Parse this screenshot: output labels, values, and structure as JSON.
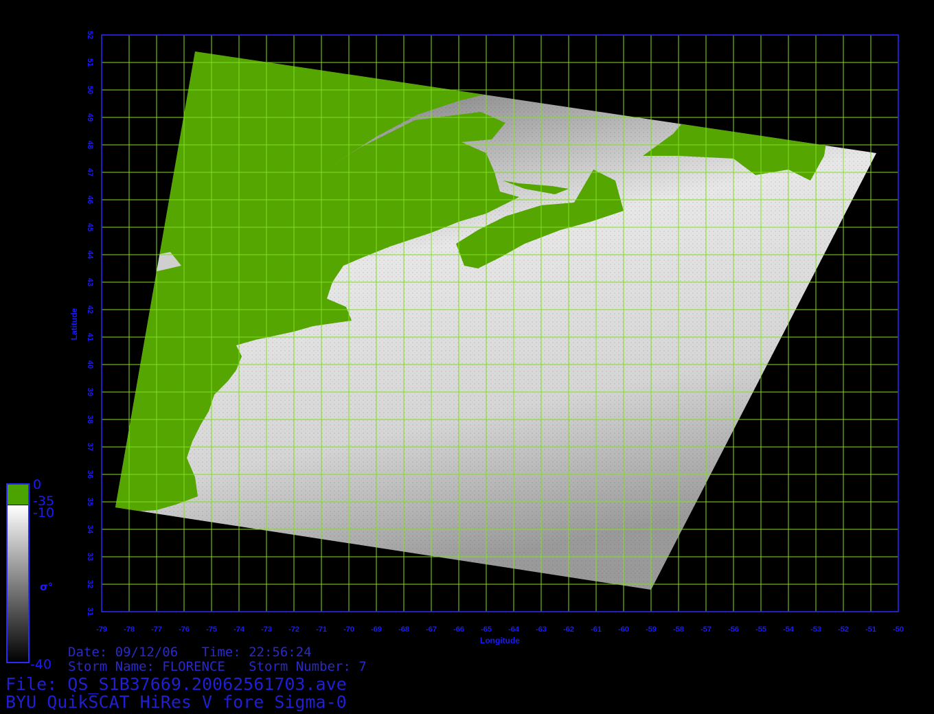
{
  "map": {
    "x_axis_label": "Longitude",
    "y_axis_label": "Latitude",
    "lon_range": [
      -79,
      -50
    ],
    "lat_range": [
      31,
      52
    ],
    "lon_ticks": [
      -79,
      -78,
      -77,
      -76,
      -75,
      -74,
      -73,
      -72,
      -71,
      -70,
      -69,
      -68,
      -67,
      -66,
      -65,
      -64,
      -63,
      -62,
      -61,
      -60,
      -59,
      -58,
      -57,
      -56,
      -55,
      -54,
      -53,
      -52,
      -51,
      -50
    ],
    "lat_ticks": [
      31,
      32,
      33,
      34,
      35,
      36,
      37,
      38,
      39,
      40,
      41,
      42,
      43,
      44,
      45,
      46,
      47,
      48,
      49,
      50,
      51,
      52
    ],
    "grid_color": "#7fe020",
    "frame_color": "#2a2aff",
    "land_color": "#55a600",
    "swath_corners": [
      [
        -75.6,
        51.4
      ],
      [
        -50.8,
        47.7
      ],
      [
        -59.0,
        31.8
      ],
      [
        -78.5,
        34.8
      ]
    ]
  },
  "colorbar": {
    "land_segment": {
      "top": "0",
      "bottom": "-35",
      "color": "#4aa300"
    },
    "sigma0_segment": {
      "top": "-10",
      "bottom": "-40"
    },
    "symbol": "σ°"
  },
  "info": {
    "date_line": "Date: 09/12/06   Time: 22:56:24",
    "storm_line": "Storm Name: FLORENCE   Storm Number: 7",
    "file_line": "File: QS_S1B37669.20062561703.ave",
    "product_line": "BYU QuikSCAT HiRes V fore Sigma-0"
  }
}
